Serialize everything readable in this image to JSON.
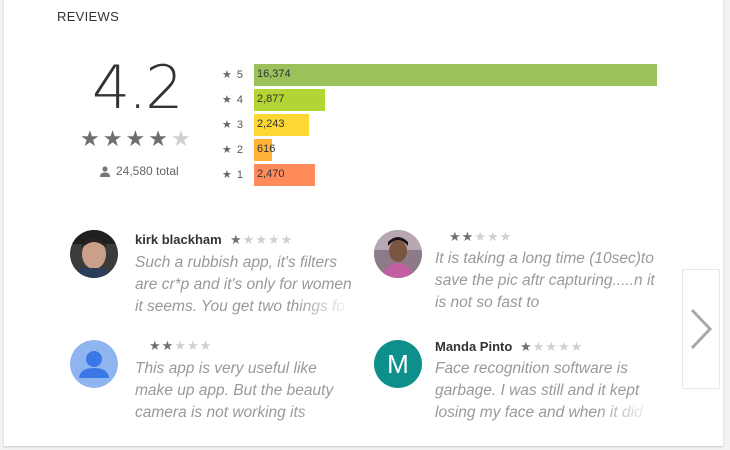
{
  "section_title": "REVIEWS",
  "rating": {
    "score": "4.2",
    "stars_filled": 4,
    "stars_total": 5,
    "total_text": "24,580 total"
  },
  "histogram": [
    {
      "stars": "5",
      "count": "16,374",
      "value": 16374,
      "color": "#9bc15b"
    },
    {
      "stars": "4",
      "count": "2,877",
      "value": 2877,
      "color": "#b3d534"
    },
    {
      "stars": "3",
      "count": "2,243",
      "value": 2243,
      "color": "#fdd835"
    },
    {
      "stars": "2",
      "count": "616",
      "value": 616,
      "color": "#ffb236"
    },
    {
      "stars": "1",
      "count": "2,470",
      "value": 2470,
      "color": "#ff8a5a"
    }
  ],
  "reviews": [
    {
      "author": "kirk blackham",
      "stars": 1,
      "text": "Such a rubbish app, it's filters are cr*p and it's only for women it seems. You get two things fo"
    },
    {
      "author": "",
      "stars": 2,
      "text": "It is taking a long time (10sec)to save the pic aftr capturing.....n it is not so fast to"
    },
    {
      "author": "",
      "stars": 2,
      "text": "This app is very useful like make up app. But the beauty camera is not working its"
    },
    {
      "author": "Manda Pinto",
      "stars": 1,
      "avatar_letter": "M",
      "text": "Face recognition software is garbage. I was still and it kept losing my face and when it did"
    }
  ],
  "colors": {
    "star_on": "#6f6f6f",
    "star_off": "#d0d0d0",
    "avatar_m_bg": "#0d8f8c",
    "avatar_default_bg": "#8eb5f0"
  },
  "icons": {
    "next": "chevron-right-icon",
    "total": "person-icon",
    "star": "star-icon"
  }
}
